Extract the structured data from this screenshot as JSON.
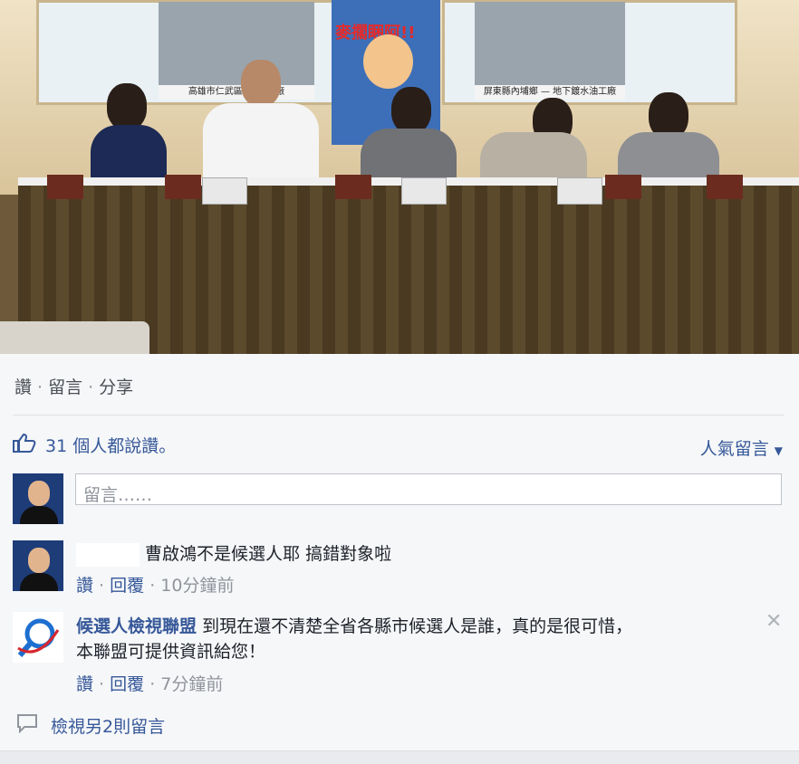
{
  "photo": {
    "poster_left_caption": "高雄市仁武區 — 煉油廠",
    "poster_cartoon_title": "麥擱睏阿!!",
    "poster_right_caption": "屏東縣內埔鄉 — 地下鍍水油工廠"
  },
  "actions": {
    "like": "讚",
    "comment": "留言",
    "share": "分享",
    "separator": "·"
  },
  "likes": {
    "icon": "thumbs-up-icon",
    "text": "31 個人都說讚。"
  },
  "sort": {
    "label": "人氣留言",
    "icon": "caret-down-icon"
  },
  "comment_input": {
    "placeholder": "留言……"
  },
  "comments": [
    {
      "author": "",
      "text": "曹啟鴻不是候選人耶 搞錯對象啦",
      "like": "讚",
      "reply": "回覆",
      "time": "10分鐘前"
    },
    {
      "author": "候選人檢視聯盟",
      "text": "到現在還不清楚全省各縣市候選人是誰，真的是很可惜，",
      "text2": "本聯盟可提供資訊給您！",
      "like": "讚",
      "reply": "回覆",
      "time": "7分鐘前"
    }
  ],
  "view_more": {
    "icon": "comment-bubble-icon",
    "label": "檢視另2則留言"
  },
  "colors": {
    "link": "#365899",
    "muted": "#90949c",
    "background": "#f6f7f9"
  }
}
